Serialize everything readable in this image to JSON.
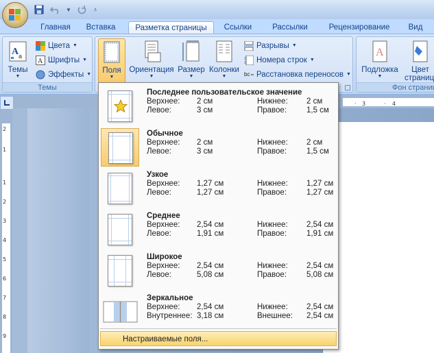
{
  "tabs": [
    "Главная",
    "Вставка",
    "Разметка страницы",
    "Ссылки",
    "Рассылки",
    "Рецензирование",
    "Вид"
  ],
  "active_tab": "Разметка страницы",
  "ribbon": {
    "themes_group": {
      "label": "Темы",
      "themes_button": "Темы",
      "colors": "Цвета",
      "fonts": "Шрифты",
      "effects": "Эффекты"
    },
    "page_setup": {
      "margins": "Поля",
      "orientation": "Ориентация",
      "size": "Размер",
      "columns": "Колонки",
      "breaks": "Разрывы",
      "line_numbers": "Номера строк",
      "hyphenation": "Расстановка переносов"
    },
    "background_group": {
      "label": "Фон страниц",
      "watermark": "Подложка",
      "page_color_line1": "Цвет",
      "page_color_line2": "страницы"
    }
  },
  "ruler": {
    "h_ticks": [
      "·",
      "3",
      "·",
      "4"
    ],
    "v_ticks": [
      "2",
      "1",
      "1",
      "2",
      "3",
      "4",
      "5",
      "6",
      "7",
      "8",
      "9",
      "10"
    ]
  },
  "margins_menu": {
    "options": [
      {
        "title": "Последнее пользовательское значение",
        "top_label": "Верхнее:",
        "top": "2 см",
        "bottom_label": "Нижнее:",
        "bottom": "2 см",
        "left_label": "Левое:",
        "left": "3 см",
        "right_label": "Правое:",
        "right": "1,5 см",
        "icon": "star-page-icon"
      },
      {
        "title": "Обычное",
        "top_label": "Верхнее:",
        "top": "2 см",
        "bottom_label": "Нижнее:",
        "bottom": "2 см",
        "left_label": "Левое:",
        "left": "3 см",
        "right_label": "Правое:",
        "right": "1,5 см",
        "icon": "page-margins-icon"
      },
      {
        "title": "Узкое",
        "top_label": "Верхнее:",
        "top": "1,27 см",
        "bottom_label": "Нижнее:",
        "bottom": "1,27 см",
        "left_label": "Левое:",
        "left": "1,27 см",
        "right_label": "Правое:",
        "right": "1,27 см",
        "icon": "page-margins-icon"
      },
      {
        "title": "Среднее",
        "top_label": "Верхнее:",
        "top": "2,54 см",
        "bottom_label": "Нижнее:",
        "bottom": "2,54 см",
        "left_label": "Левое:",
        "left": "1,91 см",
        "right_label": "Правое:",
        "right": "1,91 см",
        "icon": "page-margins-icon"
      },
      {
        "title": "Широкое",
        "top_label": "Верхнее:",
        "top": "2,54 см",
        "bottom_label": "Нижнее:",
        "bottom": "2,54 см",
        "left_label": "Левое:",
        "left": "5,08 см",
        "right_label": "Правое:",
        "right": "5,08 см",
        "icon": "page-margins-icon"
      },
      {
        "title": "Зеркальное",
        "top_label": "Верхнее:",
        "top": "2,54 см",
        "bottom_label": "Нижнее:",
        "bottom": "2,54 см",
        "left_label": "Внутреннее:",
        "left": "3,18 см",
        "right_label": "Внешнее:",
        "right": "2,54 см",
        "icon": "mirrored-pages-icon"
      }
    ],
    "selected_index": 1,
    "custom_margins": "Настраиваемые поля..."
  },
  "colors": {
    "accent": "#15428b",
    "highlight": "#f9d36d",
    "ribbon": "#c7daf3"
  }
}
